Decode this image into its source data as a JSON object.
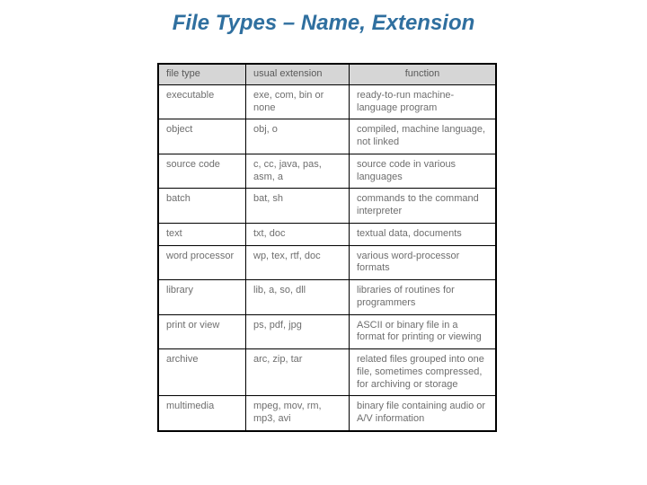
{
  "title": "File Types – Name, Extension",
  "headers": {
    "c1": "file type",
    "c2": "usual extension",
    "c3": "function"
  },
  "rows": [
    {
      "type": "executable",
      "ext": "exe, com, bin or none",
      "func": "ready-to-run machine-language program"
    },
    {
      "type": "object",
      "ext": "obj, o",
      "func": "compiled, machine language, not linked"
    },
    {
      "type": "source code",
      "ext": "c, cc, java, pas, asm, a",
      "func": "source code in various languages"
    },
    {
      "type": "batch",
      "ext": "bat, sh",
      "func": "commands to the command interpreter"
    },
    {
      "type": "text",
      "ext": "txt, doc",
      "func": "textual data, documents"
    },
    {
      "type": "word processor",
      "ext": "wp, tex, rtf, doc",
      "func": "various word-processor formats"
    },
    {
      "type": "library",
      "ext": "lib, a, so, dll",
      "func": "libraries of routines for programmers"
    },
    {
      "type": "print or view",
      "ext": "ps, pdf, jpg",
      "func": "ASCII or binary file in a format for printing or viewing"
    },
    {
      "type": "archive",
      "ext": "arc, zip, tar",
      "func": "related files grouped into one file, sometimes compressed, for archiving or storage"
    },
    {
      "type": "multimedia",
      "ext": "mpeg, mov, rm, mp3, avi",
      "func": "binary file containing audio or A/V information"
    }
  ]
}
